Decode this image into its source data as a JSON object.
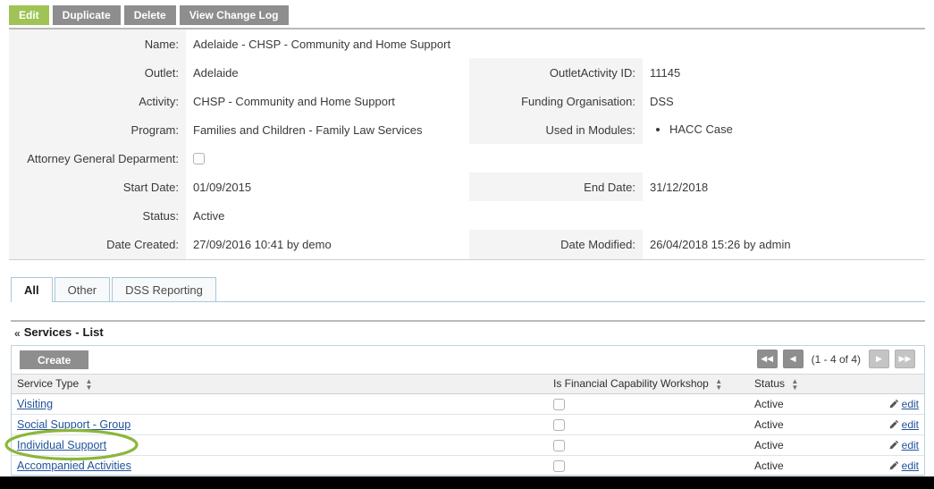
{
  "toolbar": {
    "buttons": [
      {
        "label": "Edit",
        "active": true
      },
      {
        "label": "Duplicate",
        "active": false
      },
      {
        "label": "Delete",
        "active": false
      },
      {
        "label": "View Change Log",
        "active": false
      }
    ]
  },
  "detail": {
    "name_label": "Name:",
    "name_value": "Adelaide - CHSP - Community and Home Support",
    "outlet_label": "Outlet:",
    "outlet_value": "Adelaide",
    "outlet_activity_id_label": "OutletActivity ID:",
    "outlet_activity_id_value": "11145",
    "activity_label": "Activity:",
    "activity_value": "CHSP - Community and Home Support",
    "funding_org_label": "Funding Organisation:",
    "funding_org_value": "DSS",
    "program_label": "Program:",
    "program_value": "Families and Children - Family Law Services",
    "used_in_modules_label": "Used in Modules:",
    "used_in_modules_values": [
      "HACC Case"
    ],
    "attorney_general_label": "Attorney General Deparment:",
    "attorney_general_checked": false,
    "start_date_label": "Start Date:",
    "start_date_value": "01/09/2015",
    "end_date_label": "End Date:",
    "end_date_value": "31/12/2018",
    "status_label": "Status:",
    "status_value": "Active",
    "date_created_label": "Date Created:",
    "date_created_value": "27/09/2016 10:41 by demo",
    "date_modified_label": "Date Modified:",
    "date_modified_value": "26/04/2018 15:26 by admin"
  },
  "tabs": [
    {
      "label": "All",
      "selected": true
    },
    {
      "label": "Other",
      "selected": false
    },
    {
      "label": "DSS Reporting",
      "selected": false
    }
  ],
  "panel": {
    "chevron_icon": "double-chevron-up-icon",
    "title": "Services",
    "separator": "-",
    "subtitle": "List",
    "create_label": "Create",
    "pagination": {
      "first_label": "◀◀",
      "prev_label": "◀",
      "count_label": "(1 - 4 of 4)",
      "next_label": "▶",
      "last_label": "▶▶"
    }
  },
  "table": {
    "columns": [
      {
        "label": "Service Type",
        "sortable": true
      },
      {
        "label": "Is Financial Capability Workshop",
        "sortable": true
      },
      {
        "label": "Status",
        "sortable": true
      },
      {
        "label": "",
        "sortable": false
      }
    ],
    "rows": [
      {
        "service_type": "Visiting",
        "is_fcw": false,
        "status": "Active",
        "edit_label": "edit"
      },
      {
        "service_type": "Social Support - Group",
        "is_fcw": false,
        "status": "Active",
        "edit_label": "edit"
      },
      {
        "service_type": "Individual Support",
        "is_fcw": false,
        "status": "Active",
        "edit_label": "edit"
      },
      {
        "service_type": "Accompanied Activities",
        "is_fcw": false,
        "status": "Active",
        "edit_label": "edit"
      }
    ]
  },
  "annotation": {
    "shape": "ellipse-highlight",
    "target": "Individual Support",
    "color": "#8cb63c"
  },
  "colors": {
    "accent_green": "#9fc355",
    "button_gray": "#8e8e8e",
    "link_blue": "#22539b",
    "label_bg": "#f4f4f4",
    "annotation_green": "#8cb63c"
  }
}
